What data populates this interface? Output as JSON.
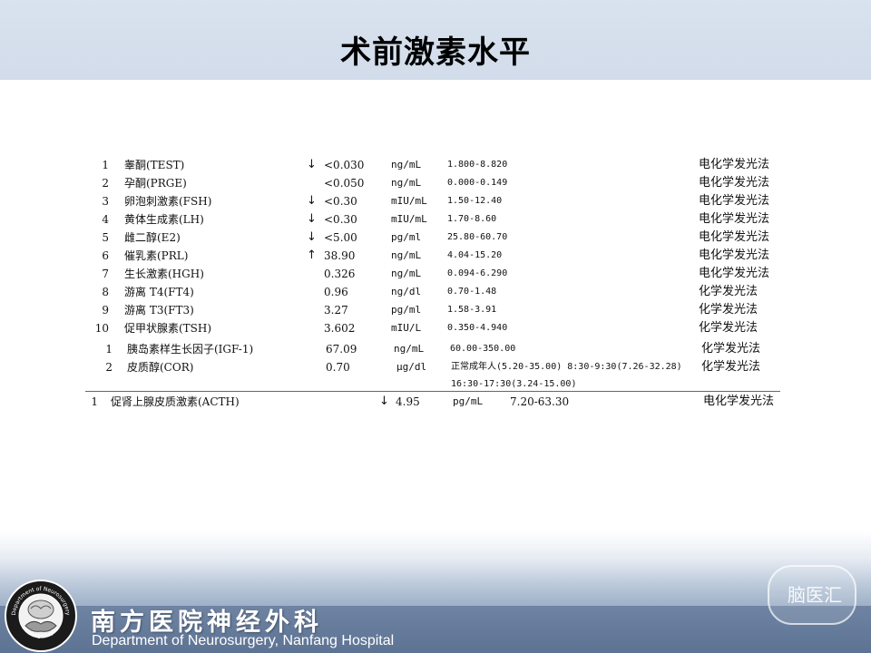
{
  "title": "术前激素水平",
  "rows": [
    {
      "num": "1",
      "name": "睾酮(TEST)",
      "arrow": "↓",
      "value": "<0.030",
      "unit": "ng/mL",
      "range": "1.800-8.820",
      "method": "电化学发光法"
    },
    {
      "num": "2",
      "name": "孕酮(PRGE)",
      "arrow": "",
      "value": "<0.050",
      "unit": "ng/mL",
      "range": "0.000-0.149",
      "method": "电化学发光法"
    },
    {
      "num": "3",
      "name": "卵泡刺激素(FSH)",
      "arrow": "↓",
      "value": "<0.30",
      "unit": "mIU/mL",
      "range": "1.50-12.40",
      "method": "电化学发光法"
    },
    {
      "num": "4",
      "name": "黄体生成素(LH)",
      "arrow": "↓",
      "value": "<0.30",
      "unit": "mIU/mL",
      "range": "1.70-8.60",
      "method": "电化学发光法"
    },
    {
      "num": "5",
      "name": "雌二醇(E2)",
      "arrow": "↓",
      "value": "<5.00",
      "unit": "pg/ml",
      "range": "25.80-60.70",
      "method": "电化学发光法"
    },
    {
      "num": "6",
      "name": "催乳素(PRL)",
      "arrow": "↑",
      "value": "38.90",
      "unit": "ng/mL",
      "range": "4.04-15.20",
      "method": "电化学发光法"
    },
    {
      "num": "7",
      "name": "生长激素(HGH)",
      "arrow": "",
      "value": "0.326",
      "unit": "ng/mL",
      "range": "0.094-6.290",
      "method": "电化学发光法"
    },
    {
      "num": "8",
      "name": "游离 T4(FT4)",
      "arrow": "",
      "value": "0.96",
      "unit": "ng/dl",
      "range": "0.70-1.48",
      "method": "化学发光法"
    },
    {
      "num": "9",
      "name": "游离 T3(FT3)",
      "arrow": "",
      "value": "3.27",
      "unit": "pg/ml",
      "range": "1.58-3.91",
      "method": "化学发光法"
    },
    {
      "num": "10",
      "name": "促甲状腺素(TSH)",
      "arrow": "",
      "value": "3.602",
      "unit": "mIU/L",
      "range": "0.350-4.940",
      "method": "化学发光法"
    }
  ],
  "rows2": [
    {
      "num": "1",
      "name": "胰岛素样生长因子(IGF-1)",
      "value": "67.09",
      "unit": "ng/mL",
      "range": "60.00-350.00",
      "method": "化学发光法"
    },
    {
      "num": "2",
      "name": "皮质醇(COR)",
      "value": "0.70",
      "unit": "μg/dl",
      "range": "正常成年人(5.20-35.00) 8:30-9:30(7.26-32.28)",
      "range2": "16:30-17:30(3.24-15.00)",
      "method": "化学发光法"
    }
  ],
  "row3": {
    "num": "1",
    "name": "促肾上腺皮质激素(ACTH)",
    "arrow": "↓",
    "value": "4.95",
    "unit": "pg/mL",
    "range": "7.20-63.30",
    "method": "电化学发光法"
  },
  "footer": {
    "dept_cn": "南方医院神经外科",
    "dept_en": "Department of Neurosurgery, Nanfang Hospital",
    "logo_text_top": "Department of Neurosurgery",
    "logo_text_bottom": "Nanfang Hospital",
    "watermark": "脑医汇"
  }
}
